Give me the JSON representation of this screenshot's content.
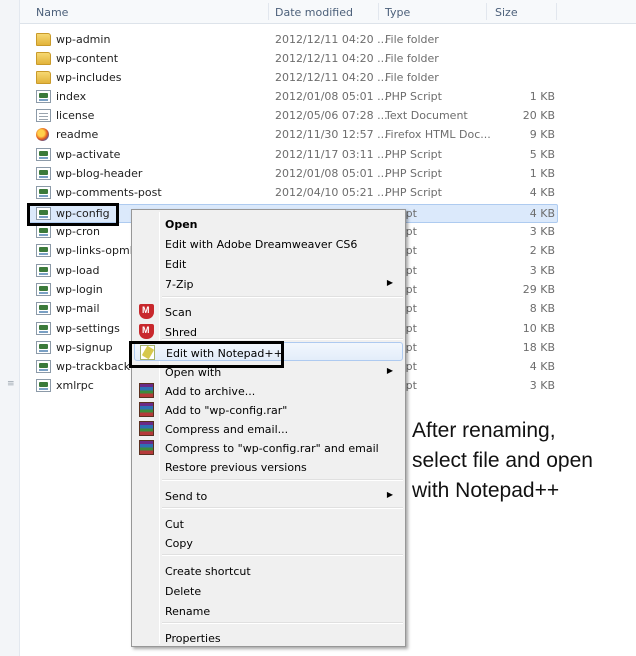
{
  "columns": {
    "name": "Name",
    "date": "Date modified",
    "type": "Type",
    "size": "Size"
  },
  "files": [
    {
      "name": "wp-admin",
      "date": "2012/12/11 04:20 ...",
      "type": "File folder",
      "size": "",
      "icon": "folder-icon"
    },
    {
      "name": "wp-content",
      "date": "2012/12/11 04:20 ...",
      "type": "File folder",
      "size": "",
      "icon": "folder-icon"
    },
    {
      "name": "wp-includes",
      "date": "2012/12/11 04:20 ...",
      "type": "File folder",
      "size": "",
      "icon": "folder-icon"
    },
    {
      "name": "index",
      "date": "2012/01/08 05:01 ...",
      "type": "PHP Script",
      "size": "1 KB",
      "icon": "php-file-icon"
    },
    {
      "name": "license",
      "date": "2012/05/06 07:28 ...",
      "type": "Text Document",
      "size": "20 KB",
      "icon": "text-file-icon"
    },
    {
      "name": "readme",
      "date": "2012/11/30 12:57 ...",
      "type": "Firefox HTML Doc...",
      "size": "9 KB",
      "icon": "firefox-html-icon"
    },
    {
      "name": "wp-activate",
      "date": "2012/11/17 03:11 ...",
      "type": "PHP Script",
      "size": "5 KB",
      "icon": "php-file-icon"
    },
    {
      "name": "wp-blog-header",
      "date": "2012/01/08 05:01 ...",
      "type": "PHP Script",
      "size": "1 KB",
      "icon": "php-file-icon"
    },
    {
      "name": "wp-comments-post",
      "date": "2012/04/10 05:21 ...",
      "type": "PHP Script",
      "size": "4 KB",
      "icon": "php-file-icon"
    },
    {
      "name": "wp-config",
      "date": "",
      "type": "Script",
      "size": "4 KB",
      "icon": "php-file-icon",
      "selected": true
    },
    {
      "name": "wp-cron",
      "date": "",
      "type": "Script",
      "size": "3 KB",
      "icon": "php-file-icon"
    },
    {
      "name": "wp-links-opml",
      "date": "",
      "type": "Script",
      "size": "2 KB",
      "icon": "php-file-icon"
    },
    {
      "name": "wp-load",
      "date": "",
      "type": "Script",
      "size": "3 KB",
      "icon": "php-file-icon"
    },
    {
      "name": "wp-login",
      "date": "",
      "type": "Script",
      "size": "29 KB",
      "icon": "php-file-icon"
    },
    {
      "name": "wp-mail",
      "date": "",
      "type": "Script",
      "size": "8 KB",
      "icon": "php-file-icon"
    },
    {
      "name": "wp-settings",
      "date": "",
      "type": "Script",
      "size": "10 KB",
      "icon": "php-file-icon"
    },
    {
      "name": "wp-signup",
      "date": "",
      "type": "Script",
      "size": "18 KB",
      "icon": "php-file-icon"
    },
    {
      "name": "wp-trackback",
      "date": "",
      "type": "Script",
      "size": "4 KB",
      "icon": "php-file-icon"
    },
    {
      "name": "xmlrpc",
      "date": "",
      "type": "Script",
      "size": "3 KB",
      "icon": "php-file-icon"
    }
  ],
  "context_menu": {
    "items": [
      {
        "label": "Open",
        "bold": true
      },
      {
        "label": "Edit with Adobe Dreamweaver CS6"
      },
      {
        "label": "Edit"
      },
      {
        "label": "7-Zip",
        "submenu": true
      },
      {
        "separator": true
      },
      {
        "label": "Scan",
        "icon": "mcafee-icon"
      },
      {
        "label": "Shred",
        "icon": "mcafee-icon"
      },
      {
        "separator": true
      },
      {
        "label": "Edit with Notepad++",
        "icon": "notepad-plus-plus-icon",
        "highlighted": true
      },
      {
        "label": "Open with",
        "submenu": true
      },
      {
        "label": "Add to archive...",
        "icon": "winrar-icon"
      },
      {
        "label": "Add to \"wp-config.rar\"",
        "icon": "winrar-icon"
      },
      {
        "label": "Compress and email...",
        "icon": "winrar-icon"
      },
      {
        "label": "Compress to \"wp-config.rar\" and email",
        "icon": "winrar-icon"
      },
      {
        "label": "Restore previous versions"
      },
      {
        "separator": true
      },
      {
        "label": "Send to",
        "submenu": true
      },
      {
        "separator": true
      },
      {
        "label": "Cut"
      },
      {
        "label": "Copy"
      },
      {
        "separator": true
      },
      {
        "label": "Create shortcut"
      },
      {
        "label": "Delete"
      },
      {
        "label": "Rename"
      },
      {
        "separator": true
      },
      {
        "label": "Properties"
      }
    ]
  },
  "annotation": {
    "lines": [
      "After renaming,",
      "select file and open",
      "with Notepad++"
    ]
  },
  "colors": {
    "selection": "#dbe9fb",
    "menu_background": "#f0f0f0",
    "highlight_box": "#000000"
  }
}
